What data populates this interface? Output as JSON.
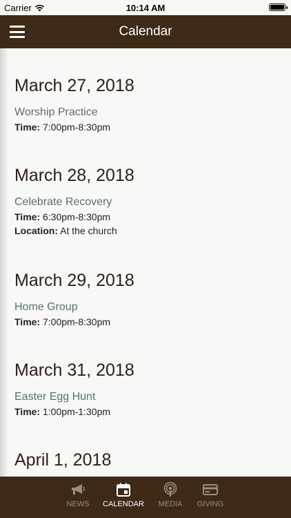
{
  "status_bar": {
    "carrier": "Carrier",
    "time": "10:14 AM"
  },
  "header": {
    "title": "Calendar"
  },
  "days": [
    {
      "date": "March 27, 2018",
      "event": "Worship Practice",
      "time_label": "Time:",
      "time_value": "7:00pm-8:30pm"
    },
    {
      "date": "March 28, 2018",
      "event": "Celebrate Recovery",
      "time_label": "Time:",
      "time_value": "6:30pm-8:30pm",
      "location_label": "Location:",
      "location_value": "At the church"
    },
    {
      "date": "March 29, 2018",
      "event": "Home Group",
      "time_label": "Time:",
      "time_value": "7:00pm-8:30pm"
    },
    {
      "date": "March 31, 2018",
      "event": "Easter Egg Hunt",
      "time_label": "Time:",
      "time_value": "1:00pm-1:30pm"
    },
    {
      "date": "April 1, 2018"
    }
  ],
  "tabs": [
    {
      "label": "NEWS",
      "icon": "megaphone-icon"
    },
    {
      "label": "CALENDAR",
      "icon": "calendar-icon",
      "active": true
    },
    {
      "label": "MEDIA",
      "icon": "podcast-icon"
    },
    {
      "label": "GIVING",
      "icon": "credit-card-icon"
    }
  ],
  "colors": {
    "header_bg": "#3f2a17",
    "event_name": "#5b6f6a",
    "tab_inactive": "#9a8d80"
  }
}
